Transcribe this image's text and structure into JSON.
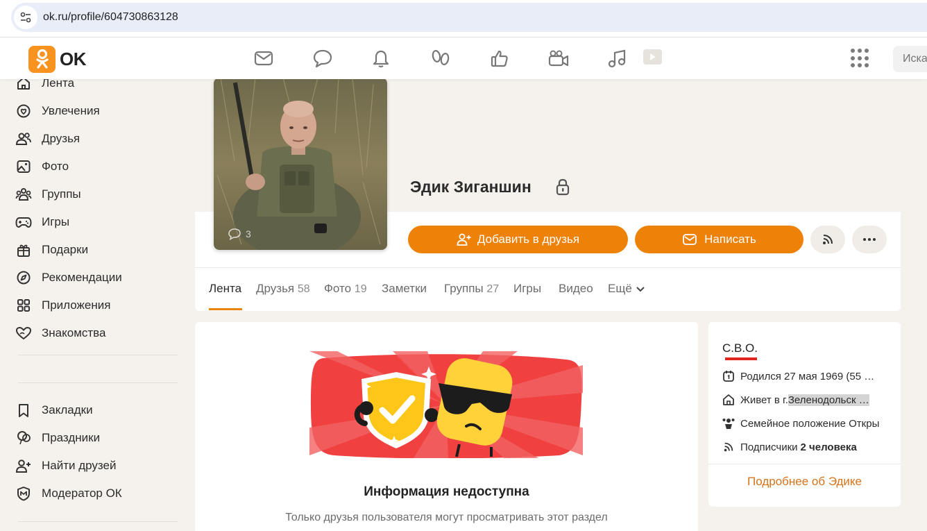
{
  "browser": {
    "url": "ok.ru/profile/604730863128"
  },
  "header": {
    "logo_text": "OK",
    "nav_icons": [
      "mail-icon",
      "chat-icon",
      "bell-icon",
      "guests-icon",
      "like-icon",
      "video-camera-icon",
      "music-icon",
      "play-icon"
    ],
    "search_placeholder": "Иска"
  },
  "sidebar": {
    "items": [
      {
        "label": "Лента",
        "icon": "home-icon"
      },
      {
        "label": "Увлечения",
        "icon": "hobby-icon"
      },
      {
        "label": "Друзья",
        "icon": "friends-icon"
      },
      {
        "label": "Фото",
        "icon": "photo-icon"
      },
      {
        "label": "Группы",
        "icon": "groups-icon"
      },
      {
        "label": "Игры",
        "icon": "gamepad-icon"
      },
      {
        "label": "Подарки",
        "icon": "gift-icon"
      },
      {
        "label": "Рекомендации",
        "icon": "compass-icon"
      },
      {
        "label": "Приложения",
        "icon": "apps-icon"
      },
      {
        "label": "Знакомства",
        "icon": "dating-icon"
      }
    ],
    "items_bottom": [
      {
        "label": "Закладки",
        "icon": "bookmark-icon"
      },
      {
        "label": "Праздники",
        "icon": "balloon-icon"
      },
      {
        "label": "Найти друзей",
        "icon": "add-friend-icon"
      },
      {
        "label": "Модератор ОК",
        "icon": "moderator-icon"
      }
    ]
  },
  "profile": {
    "name": "Эдик Зиганшин",
    "avatar_comments": "3",
    "add_friend_label": "Добавить в друзья",
    "write_label": "Написать"
  },
  "tabs": [
    {
      "label": "Лента",
      "count": ""
    },
    {
      "label": "Друзья",
      "count": "58"
    },
    {
      "label": "Фото",
      "count": "19"
    },
    {
      "label": "Заметки",
      "count": ""
    },
    {
      "label": "Группы",
      "count": "27"
    },
    {
      "label": "Игры",
      "count": ""
    },
    {
      "label": "Видео",
      "count": ""
    },
    {
      "label": "Ещё",
      "count": ""
    }
  ],
  "content": {
    "title": "Информация недоступна",
    "text": "Только друзья пользователя могут просматривать этот раздел"
  },
  "info": {
    "status": "С.В.О.",
    "born": "Родился 27 мая 1969 (55 …",
    "lives_prefix": "Живет в г. ",
    "lives_city": "Зеленодольск …",
    "family": "Семейное положение Откры",
    "subscribers_prefix": "Подписчики ",
    "subscribers_value": "2 человека",
    "more_link": "Подробнее об Эдике"
  },
  "colors": {
    "accent": "#ee8208",
    "status_line": "#e1241c",
    "link": "#d6731a"
  }
}
